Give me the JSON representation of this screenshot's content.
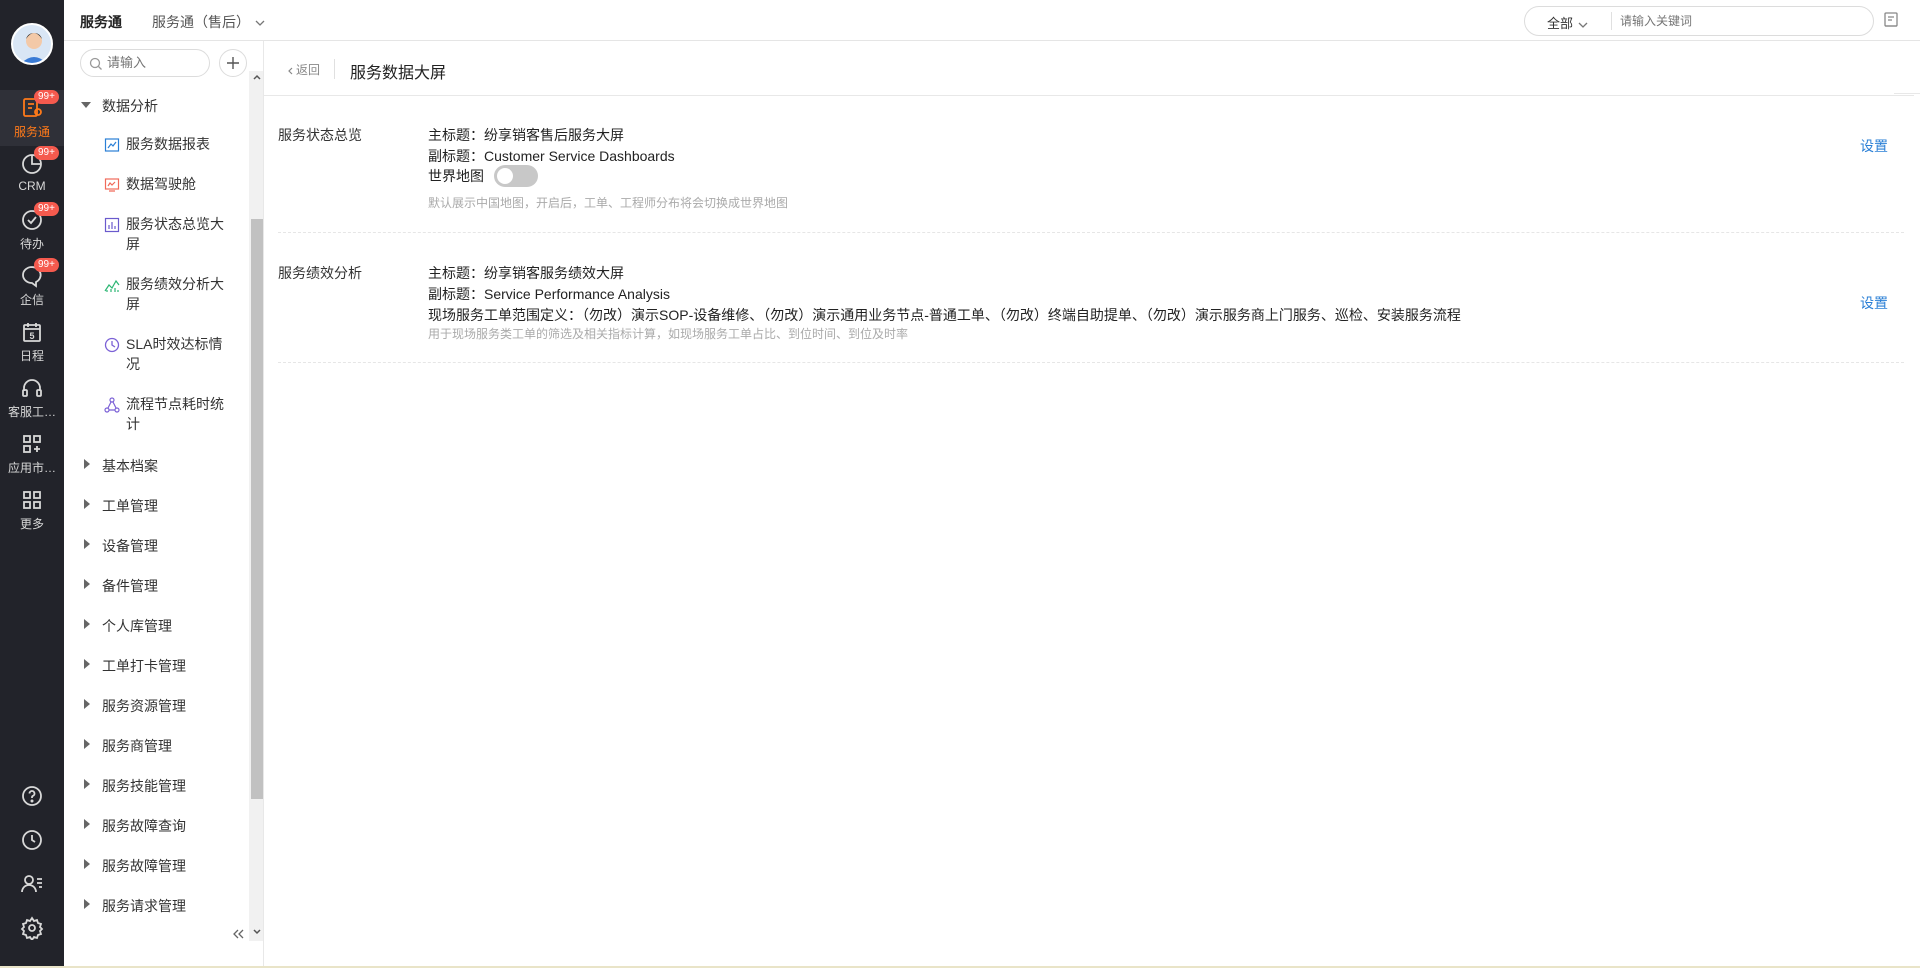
{
  "topbar": {
    "app_title": "服务通",
    "app_switch": "服务通（售后）",
    "search_scope": "全部",
    "search_placeholder": "请输入关键词"
  },
  "leftnav": {
    "items": [
      {
        "label": "服务通",
        "icon": "service-icon",
        "badge": "99+",
        "active": true
      },
      {
        "label": "CRM",
        "icon": "pie-chart-icon",
        "badge": "99+"
      },
      {
        "label": "待办",
        "icon": "check-circle-icon",
        "badge": "99+"
      },
      {
        "label": "企信",
        "icon": "chat-bubble-icon",
        "badge": "99+"
      },
      {
        "label": "日程",
        "icon": "calendar-icon",
        "calendar_day": "5"
      },
      {
        "label": "客服工…",
        "icon": "headset-icon"
      },
      {
        "label": "应用市…",
        "icon": "app-market-icon"
      },
      {
        "label": "更多",
        "icon": "grid-icon"
      }
    ],
    "bottom_icons": [
      "help-icon",
      "history-icon",
      "contacts-icon",
      "settings-icon"
    ]
  },
  "sidebar": {
    "search_placeholder": "请输入",
    "expanded_group": "数据分析",
    "leaves": [
      {
        "label": "服务数据报表",
        "icon": "report-icon",
        "color": "#2a7fd6"
      },
      {
        "label": "数据驾驶舱",
        "icon": "cockpit-icon",
        "color": "#f06a5a"
      },
      {
        "label": "服务状态总览大屏",
        "icon": "bar-chart-icon",
        "color": "#6a5acd"
      },
      {
        "label": "服务绩效分析大屏",
        "icon": "line-chart-icon",
        "color": "#2bb673"
      },
      {
        "label": "SLA时效达标情况",
        "icon": "clock-icon",
        "color": "#7b61d6"
      },
      {
        "label": "流程节点耗时统计",
        "icon": "flow-icon",
        "color": "#7b61d6"
      }
    ],
    "groups": [
      "基本档案",
      "工单管理",
      "设备管理",
      "备件管理",
      "个人库管理",
      "工单打卡管理",
      "服务资源管理",
      "服务商管理",
      "服务技能管理",
      "服务故障查询",
      "服务故障管理",
      "服务请求管理"
    ]
  },
  "main": {
    "back_label": "返回",
    "page_title": "服务数据大屏",
    "sections": [
      {
        "title": "服务状态总览",
        "main_title": "主标题：纷享销客售后服务大屏",
        "sub_title": "副标题：Customer Service Dashboards",
        "toggle_label": "世界地图",
        "toggle_on": false,
        "hint": "默认展示中国地图，开启后，工单、工程师分布将会切换成世界地图",
        "settings_label": "设置"
      },
      {
        "title": "服务绩效分析",
        "main_title": "主标题：纷享销客服务绩效大屏",
        "sub_title": "副标题：Service Performance Analysis",
        "scope_def": "现场服务工单范围定义：（勿改）演示SOP-设备维修、（勿改）演示通用业务节点-普通工单、（勿改）终端自助提单、（勿改）演示服务商上门服务、巡检、安装服务流程",
        "hint": "用于现场服务类工单的筛选及相关指标计算，如现场服务工单占比、到位时间、到位及时率",
        "settings_label": "设置"
      }
    ]
  },
  "colors": {
    "nav_bg": "#22232a",
    "accent": "#ff7a1a",
    "badge": "#f55a4e",
    "link": "#2a7fd6"
  }
}
